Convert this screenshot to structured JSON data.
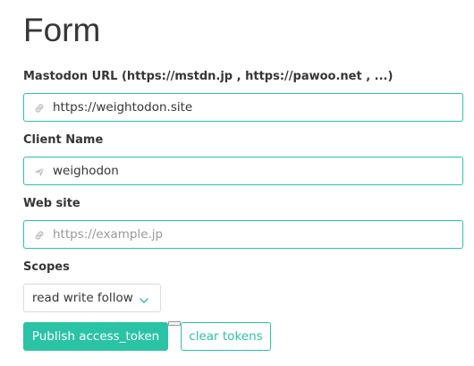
{
  "page": {
    "title": "Form"
  },
  "colors": {
    "accent": "#2bc3a5",
    "text": "#363636",
    "placeholder": "#9a9a9a",
    "neutral_border": "#dbdbdb"
  },
  "fields": {
    "mastodon_url": {
      "label": "Mastodon URL (https://mstdn.jp , https://pawoo.net , ...)",
      "value": "https://weightodon.site",
      "placeholder": "",
      "icon": "link-icon"
    },
    "client_name": {
      "label": "Client Name",
      "value": "weighodon",
      "placeholder": "",
      "icon": "paper-plane-icon"
    },
    "web_site": {
      "label": "Web site",
      "value": "",
      "placeholder": "https://example.jp",
      "icon": "link-icon"
    },
    "scopes": {
      "label": "Scopes",
      "selected": "read write follow",
      "icon": "chevron-down-icon"
    }
  },
  "actions": {
    "publish_label": "Publish access_token",
    "clear_label": "clear tokens"
  }
}
